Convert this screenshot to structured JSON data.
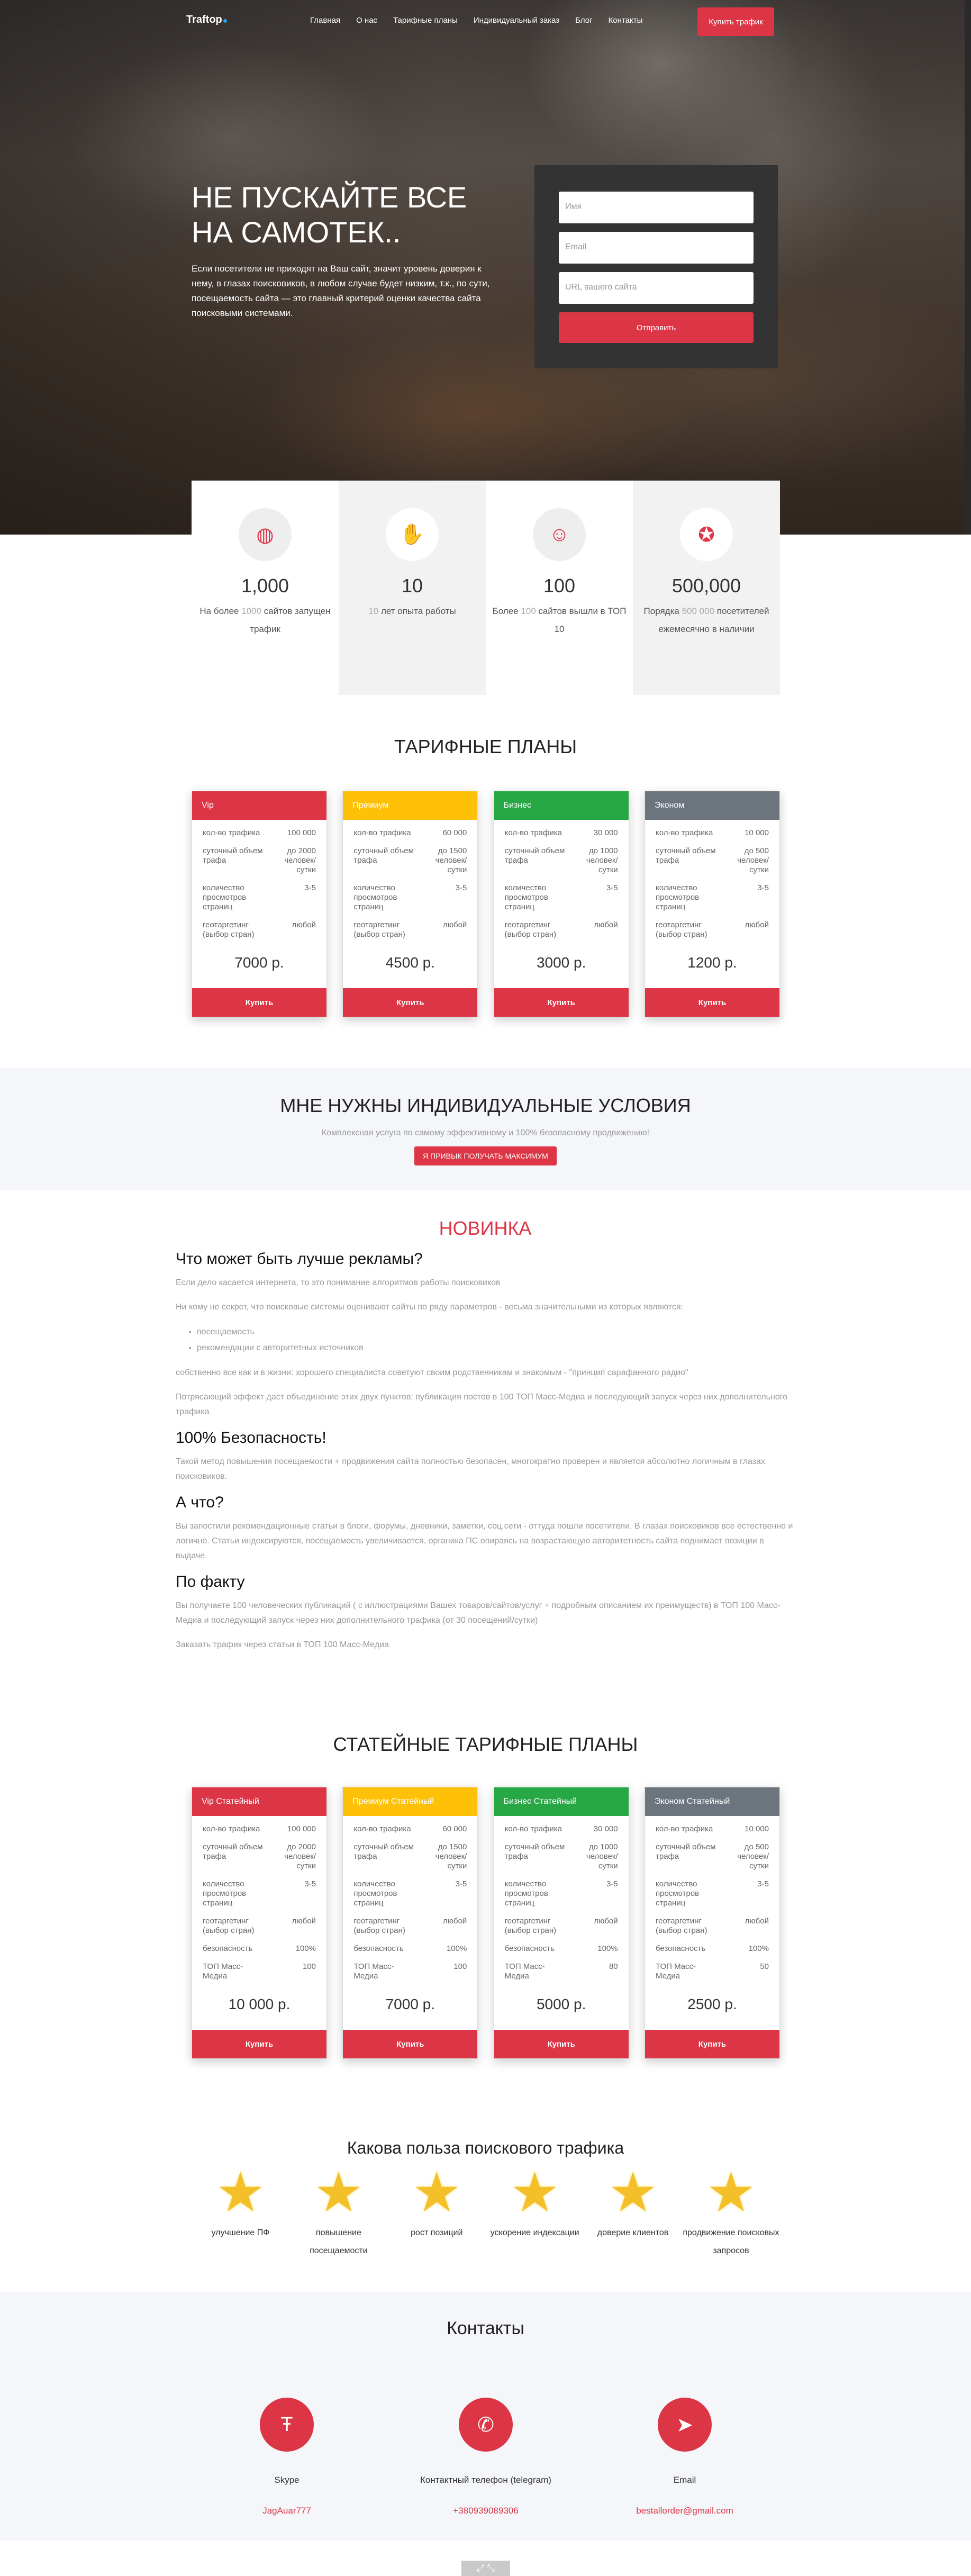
{
  "nav": {
    "logo": "Traftop",
    "items": [
      "Главная",
      "О нас",
      "Тарифные планы",
      "Индивидуальный заказ",
      "Блог",
      "Контакты"
    ],
    "buy": "Купить трафик"
  },
  "hero": {
    "title": "НЕ ПУСКАЙТЕ ВСЕ НА САМОТЕК..",
    "text": "Если посетители не приходят на Ваш сайт, значит уровень доверия к нему, в глазах поисковиков, в любом случае будет низким, т.к., по сути, посещаемость сайта — это главный критерий оценки качества сайта поисковыми системами.",
    "form": {
      "name_ph": "Имя",
      "email_ph": "Email",
      "url_ph": "URL вашего сайта",
      "send": "Отправить"
    }
  },
  "stats": [
    {
      "icon": "cookie-icon",
      "num": "1,000",
      "pre": "На более ",
      "hl": "1000",
      "post": " сайтов запущен трафик"
    },
    {
      "icon": "handshake-icon",
      "num": "10",
      "pre": "",
      "hl": "10",
      "post": " лет опыта работы"
    },
    {
      "icon": "user-icon",
      "num": "100",
      "pre": "Более ",
      "hl": "100",
      "post": " сайтов вышли в ТОП 10"
    },
    {
      "icon": "award-icon",
      "num": "500,000",
      "pre": "Порядка ",
      "hl": "500 000",
      "post": " посетителей ежемесячно в наличии"
    }
  ],
  "plans_title": "ТАРИФНЫЕ ПЛАНЫ",
  "plans": [
    {
      "name": "Vip",
      "color": "#dc3545",
      "rows": [
        [
          "кол-во трафика",
          "100 000"
        ],
        [
          "суточный объем трафа",
          "до 2000 человек/ сутки"
        ],
        [
          "количество просмотров страниц",
          "3-5"
        ],
        [
          "геотаргетинг (выбор стран)",
          "любой"
        ]
      ],
      "price": "7000 р.",
      "btn": "Купить"
    },
    {
      "name": "Премиум",
      "color": "#ffc107",
      "rows": [
        [
          "кол-во трафика",
          "60 000"
        ],
        [
          "суточный объем трафа",
          "до 1500 человек/ сутки"
        ],
        [
          "количество просмотров страниц",
          "3-5"
        ],
        [
          "геотаргетинг (выбор стран)",
          "любой"
        ]
      ],
      "price": "4500 р.",
      "btn": "Купить"
    },
    {
      "name": "Бизнес",
      "color": "#28a745",
      "rows": [
        [
          "кол-во трафика",
          "30 000"
        ],
        [
          "суточный объем трафа",
          "до 1000 человек/ сутки"
        ],
        [
          "количество просмотров страниц",
          "3-5"
        ],
        [
          "геотаргетинг (выбор стран)",
          "любой"
        ]
      ],
      "price": "3000 р.",
      "btn": "Купить"
    },
    {
      "name": "Эконом",
      "color": "#6c757d",
      "rows": [
        [
          "кол-во трафика",
          "10 000"
        ],
        [
          "суточный объем трафа",
          "до 500 человек/ сутки"
        ],
        [
          "количество просмотров страниц",
          "3-5"
        ],
        [
          "геотаргетинг (выбор стран)",
          "любой"
        ]
      ],
      "price": "1200 р.",
      "btn": "Купить"
    }
  ],
  "indiv": {
    "title": "МНЕ НУЖНЫ ИНДИВИДУАЛЬНЫЕ УСЛОВИЯ",
    "sub": "Комплексная услуга по самому эффективному и 100% безопасному продвижению!",
    "btn": "Я ПРИВЫК ПОЛУЧАТЬ МАКСИМУМ"
  },
  "article": {
    "label": "НОВИНКА",
    "h1": "Что может быть лучше рекламы?",
    "p1": "Если дело касается интернета, то это понимание алгоритмов работы поисковиков",
    "p2": "Ни кому не секрет, что поисковые системы оценивают сайты по ряду параметров - весьма значительными из которых являются:",
    "li1": "посещаемость",
    "li2": "рекомендации с авторитетных источников",
    "p3": "собственно все как и в жизни: хорошего специалиста советуют своим родственникам и знакомым - \"принцип сарафанного радио\"",
    "p4": "Потрясающий эффект даст объединение этих двух пунктов: публикация постов в 100 ТОП Масс-Медиа и последующий запуск через них дополнительного трафика",
    "h2": "100% Безопасность!",
    "p5": "Такой метод повышения посещаемости + продвижения сайта полностью безопасен, многократно проверен и является абсолютно логичным в глазах поисковиков.",
    "h3": "А что?",
    "p6": "Вы запостили рекомендационные статьи в блоги, форумы, дневники, заметки, соц.сети - оттуда пошли посетители. В глазах поисковиков все естественно и логично. Статьи индексируются, посещаемость увеличивается, органика ПС опираясь на возрастающую авторитетность сайта поднимает позиции в выдаче.",
    "h4": "По факту",
    "p7": "Вы получаете 100 человеческих публикаций ( с иллюстрациями Вашех товаров/сайтов/услуг + подробным описанием их преимуществ) в ТОП 100 Масс-Медиа и последующий запуск через них дополнительного трафика (от 30 посещений/сутки)",
    "p8": "Заказать трафик через статьи в ТОП 100 Масс-Медиа"
  },
  "art_plans_title": "СТАТЕЙНЫЕ ТАРИФНЫЕ ПЛАНЫ",
  "art_plans": [
    {
      "name": "Vip Статейный",
      "color": "#dc3545",
      "rows": [
        [
          "кол-во трафика",
          "100 000"
        ],
        [
          "суточный объем трафа",
          "до 2000 человек/ сутки"
        ],
        [
          "количество просмотров страниц",
          "3-5"
        ],
        [
          "геотаргетинг (выбор стран)",
          "любой"
        ],
        [
          "безопасность",
          "100%"
        ],
        [
          "ТОП Масс-Медиа",
          "100"
        ]
      ],
      "price": "10 000 р.",
      "btn": "Купить"
    },
    {
      "name": "Премиум Статейный",
      "color": "#ffc107",
      "rows": [
        [
          "кол-во трафика",
          "60 000"
        ],
        [
          "суточный объем трафа",
          "до 1500 человек/ сутки"
        ],
        [
          "количество просмотров страниц",
          "3-5"
        ],
        [
          "геотаргетинг (выбор стран)",
          "любой"
        ],
        [
          "безопасность",
          "100%"
        ],
        [
          "ТОП Масс-Медиа",
          "100"
        ]
      ],
      "price": "7000 р.",
      "btn": "Купить"
    },
    {
      "name": "Бизнес Статейный",
      "color": "#28a745",
      "rows": [
        [
          "кол-во трафика",
          "30 000"
        ],
        [
          "суточный объем трафа",
          "до 1000 человек/ сутки"
        ],
        [
          "количество просмотров страниц",
          "3-5"
        ],
        [
          "геотаргетинг (выбор стран)",
          "любой"
        ],
        [
          "безопасность",
          "100%"
        ],
        [
          "ТОП Масс-Медиа",
          "80"
        ]
      ],
      "price": "5000 р.",
      "btn": "Купить"
    },
    {
      "name": "Эконом Статейный",
      "color": "#6c757d",
      "rows": [
        [
          "кол-во трафика",
          "10 000"
        ],
        [
          "суточный объем трафа",
          "до 500 человек/ сутки"
        ],
        [
          "количество просмотров страниц",
          "3-5"
        ],
        [
          "геотаргетинг (выбор стран)",
          "любой"
        ],
        [
          "безопасность",
          "100%"
        ],
        [
          "ТОП Масс-Медиа",
          "50"
        ]
      ],
      "price": "2500 р.",
      "btn": "Купить"
    }
  ],
  "benefits_title": "Какова польза поискового трафика",
  "benefits": [
    "улучшение ПФ",
    "повышение посещаемости",
    "рост позиций",
    "ускорение индексации",
    "доверие клиентов",
    "продвижение поисковых запросов"
  ],
  "contacts": {
    "title": "Контакты",
    "items": [
      {
        "icon": "skype-icon",
        "label": "Skype",
        "value": "JagAuar777"
      },
      {
        "icon": "phone-icon",
        "label": "Контактный телефон (telegram)",
        "value": "+380939089306"
      },
      {
        "icon": "paper-plane-icon",
        "label": "Email",
        "value": "bestallorder@gmail.com"
      }
    ]
  }
}
